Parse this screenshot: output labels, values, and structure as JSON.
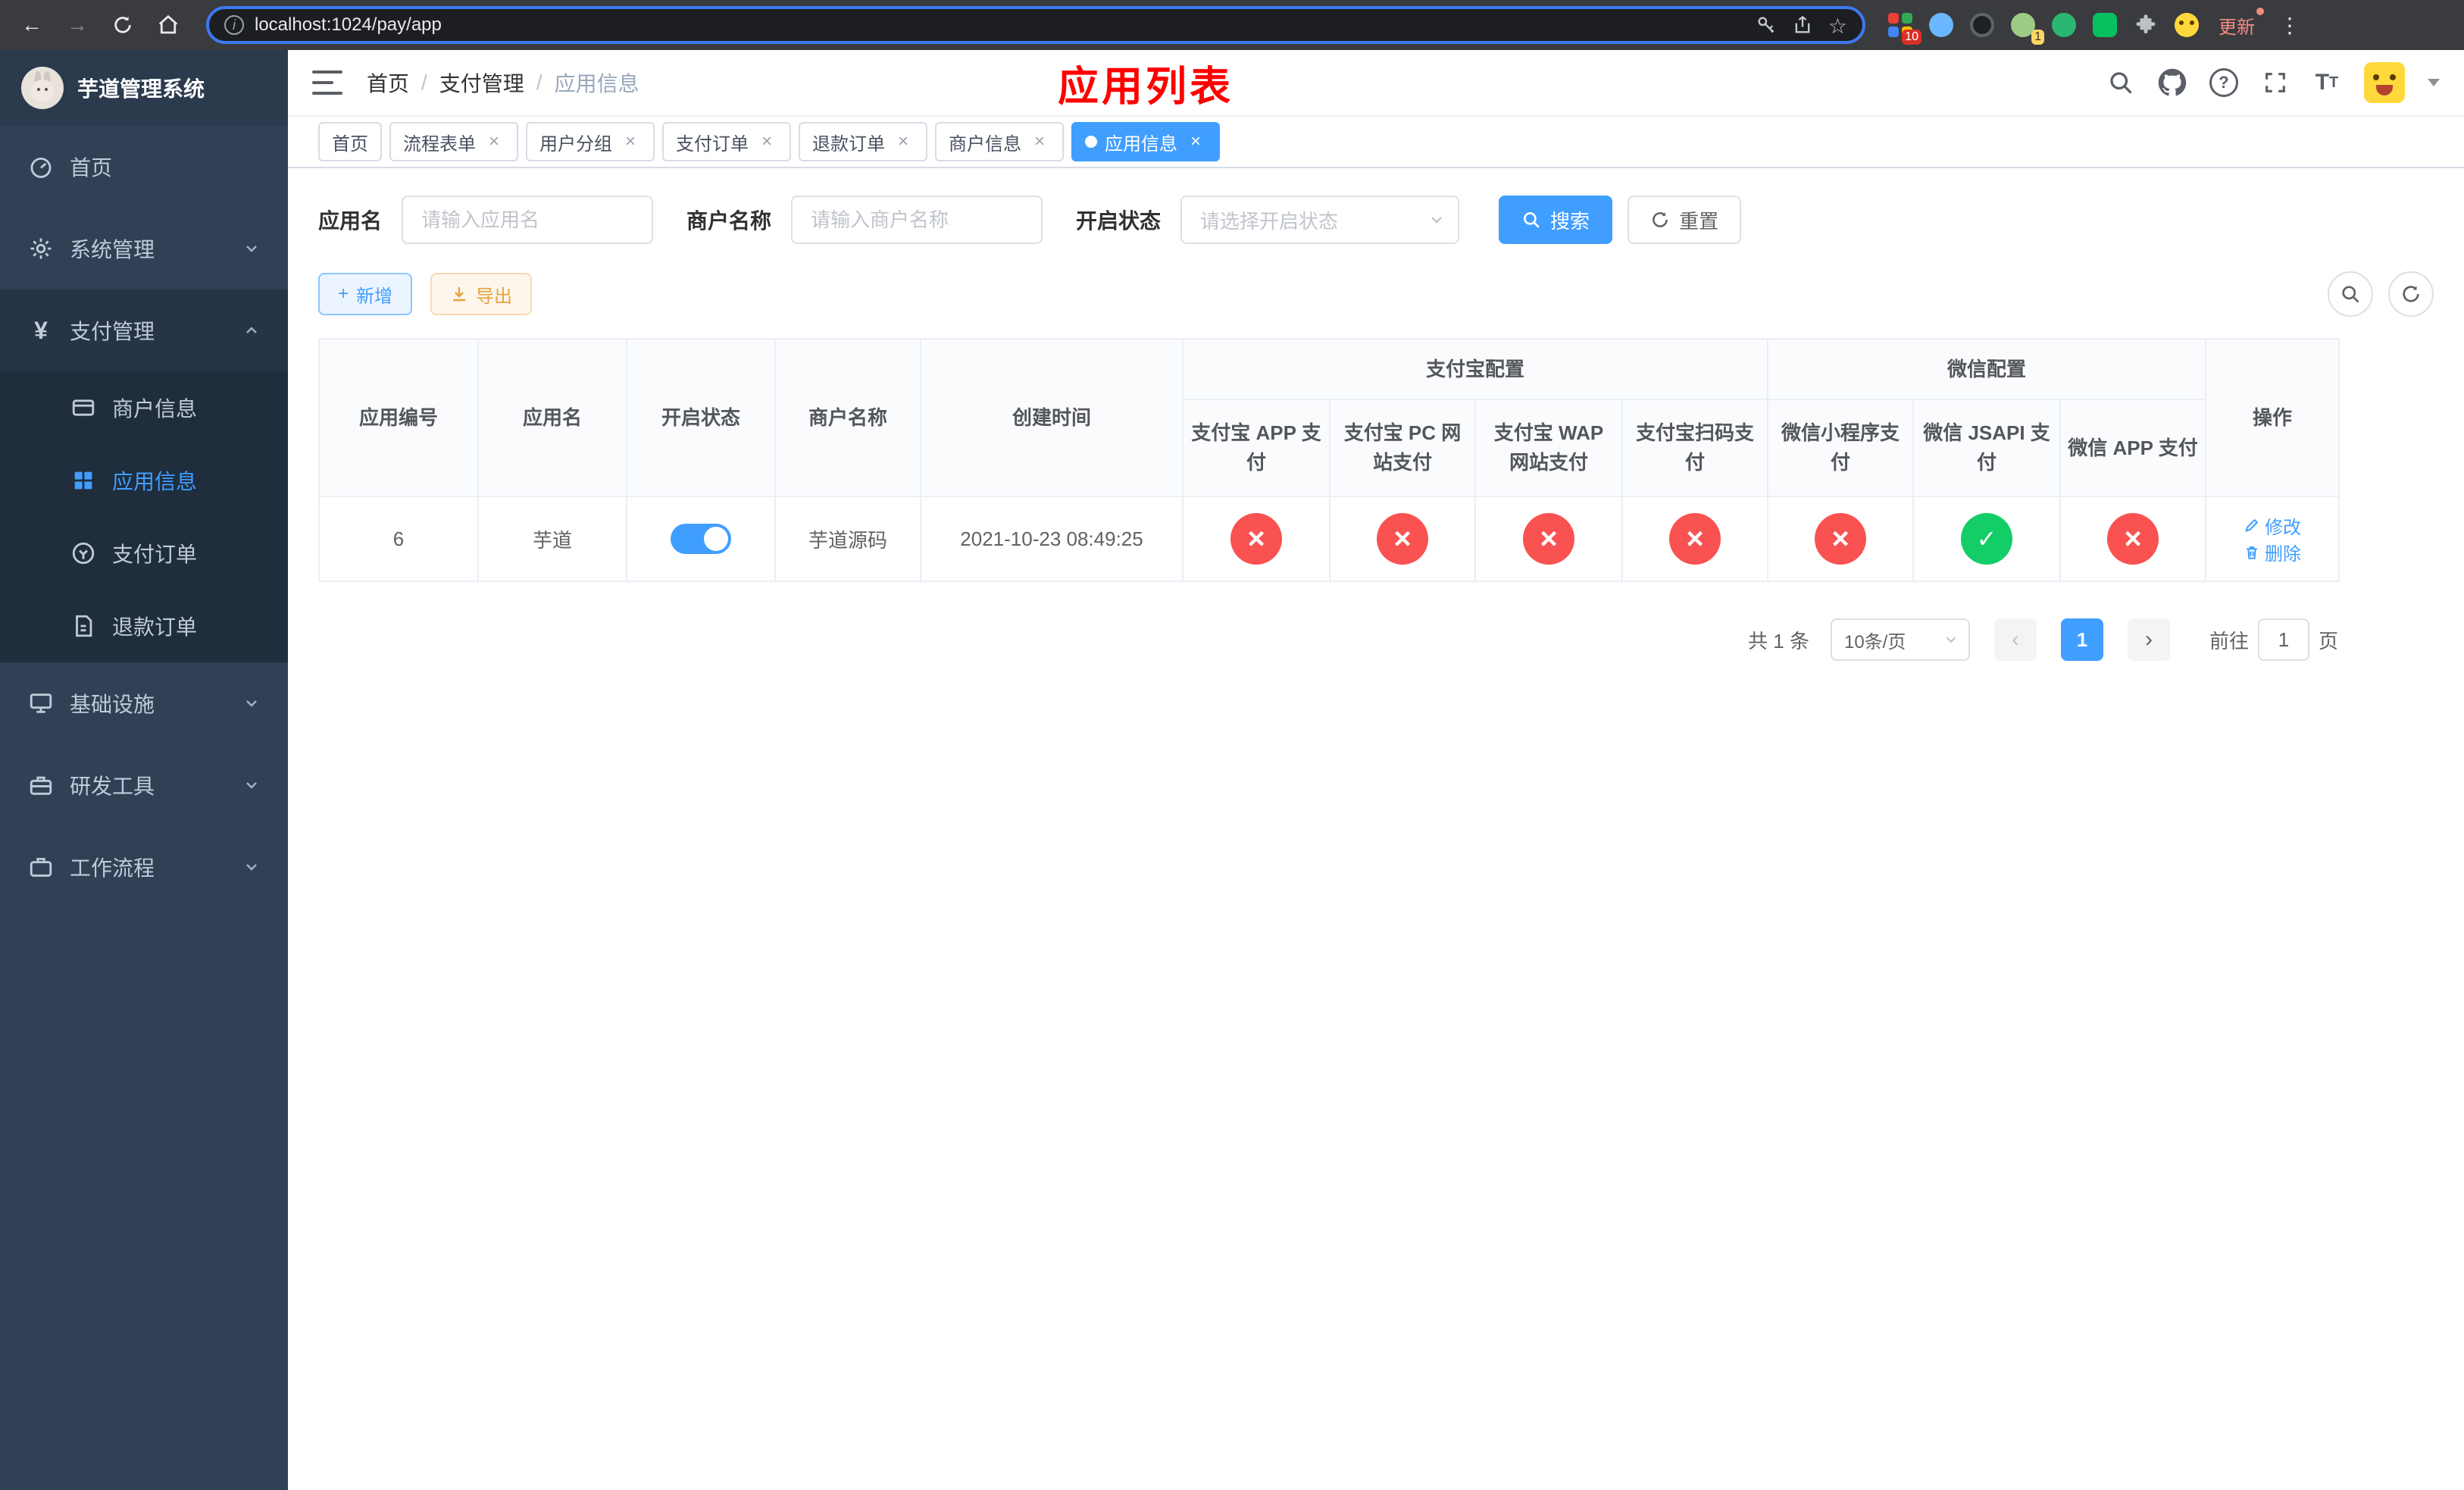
{
  "colors": {
    "primary": "#409EFF",
    "danger": "#fa5151",
    "success": "#13ce66",
    "warning": "#e6a23c",
    "banner_red": "#ff0000",
    "sidebar_bg": "#304156",
    "sidebar_submenu_bg": "#1f2d3d"
  },
  "browser": {
    "url": "localhost:1024/pay/app",
    "update_label": "更新",
    "ext_badge_grid": "10",
    "ext_badge_avatar": "1"
  },
  "sidebar": {
    "logo_title": "芋道管理系统",
    "items": [
      {
        "label": "首页"
      },
      {
        "label": "系统管理"
      },
      {
        "label": "支付管理"
      },
      {
        "label": "商户信息"
      },
      {
        "label": "应用信息"
      },
      {
        "label": "支付订单"
      },
      {
        "label": "退款订单"
      },
      {
        "label": "基础设施"
      },
      {
        "label": "研发工具"
      },
      {
        "label": "工作流程"
      }
    ]
  },
  "header": {
    "breadcrumb": [
      "首页",
      "支付管理",
      "应用信息"
    ],
    "banner": "应用列表"
  },
  "tabs": [
    {
      "label": "首页"
    },
    {
      "label": "流程表单"
    },
    {
      "label": "用户分组"
    },
    {
      "label": "支付订单"
    },
    {
      "label": "退款订单"
    },
    {
      "label": "商户信息"
    },
    {
      "label": "应用信息"
    }
  ],
  "filters": {
    "app_name_label": "应用名",
    "app_name_placeholder": "请输入应用名",
    "merchant_label": "商户名称",
    "merchant_placeholder": "请输入商户名称",
    "status_label": "开启状态",
    "status_placeholder": "请选择开启状态",
    "search_label": "搜索",
    "reset_label": "重置"
  },
  "toolbar": {
    "add_label": "新增",
    "export_label": "导出"
  },
  "table": {
    "group_alipay": "支付宝配置",
    "group_wechat": "微信配置",
    "columns": [
      "应用编号",
      "应用名",
      "开启状态",
      "商户名称",
      "创建时间",
      "支付宝 APP 支付",
      "支付宝 PC 网站支付",
      "支付宝 WAP 网站支付",
      "支付宝扫码支付",
      "微信小程序支付",
      "微信 JSAPI 支付",
      "微信 APP 支付",
      "操作"
    ],
    "row": {
      "id": "6",
      "name": "芋道",
      "status_on": true,
      "merchant": "芋道源码",
      "created": "2021-10-23 08:49:25",
      "configs": [
        "no",
        "no",
        "no",
        "no",
        "no",
        "yes",
        "no"
      ],
      "edit_label": "修改",
      "delete_label": "删除"
    }
  },
  "pagination": {
    "total_text": "共 1 条",
    "page_size": "10条/页",
    "page": "1",
    "goto_label": "前往",
    "goto_value": "1",
    "page_unit": "页"
  }
}
